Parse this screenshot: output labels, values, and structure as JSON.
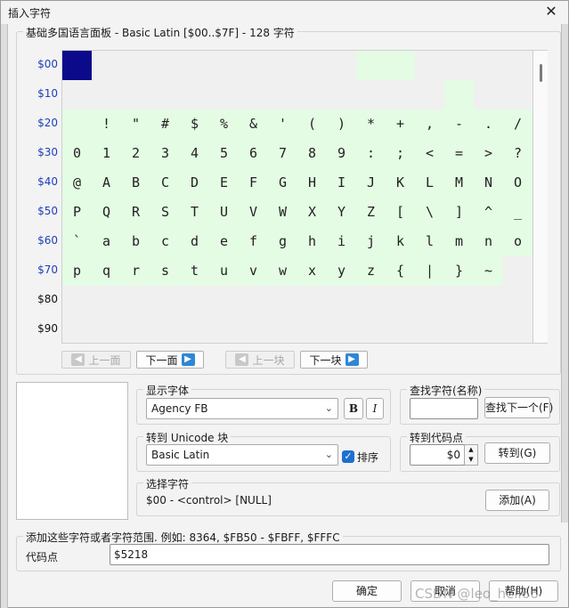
{
  "window": {
    "title": "插入字符",
    "close_label": "✕"
  },
  "panel": {
    "title": "基础多国语言面板 - Basic Latin [$00..$7F] - 128 字符"
  },
  "row_labels": [
    "$00",
    "$10",
    "$20",
    "$30",
    "$40",
    "$50",
    "$60",
    "$70",
    "$80",
    "$90"
  ],
  "rows": [
    [
      "",
      "",
      "",
      "",
      "",
      "",
      "",
      "",
      "",
      "",
      "",
      "",
      "",
      "",
      "",
      ""
    ],
    [
      "",
      "",
      "",
      "",
      "",
      "",
      "",
      "",
      "",
      "",
      "",
      "",
      "",
      "",
      "",
      ""
    ],
    [
      "",
      "!",
      "\"",
      "#",
      "$",
      "%",
      "&",
      "'",
      "(",
      ")",
      "*",
      "+",
      ",",
      "-",
      ".",
      "/"
    ],
    [
      "0",
      "1",
      "2",
      "3",
      "4",
      "5",
      "6",
      "7",
      "8",
      "9",
      ":",
      ";",
      "<",
      "=",
      ">",
      "?"
    ],
    [
      "@",
      "A",
      "B",
      "C",
      "D",
      "E",
      "F",
      "G",
      "H",
      "I",
      "J",
      "K",
      "L",
      "M",
      "N",
      "O"
    ],
    [
      "P",
      "Q",
      "R",
      "S",
      "T",
      "U",
      "V",
      "W",
      "X",
      "Y",
      "Z",
      "[",
      "\\",
      "]",
      "^",
      "_"
    ],
    [
      "`",
      "a",
      "b",
      "c",
      "d",
      "e",
      "f",
      "g",
      "h",
      "i",
      "j",
      "k",
      "l",
      "m",
      "n",
      "o"
    ],
    [
      "p",
      "q",
      "r",
      "s",
      "t",
      "u",
      "v",
      "w",
      "x",
      "y",
      "z",
      "{",
      "|",
      "}",
      "~",
      ""
    ],
    [
      "",
      "",
      "",
      "",
      "",
      "",
      "",
      "",
      "",
      "",
      "",
      "",
      "",
      "",
      "",
      ""
    ],
    [
      "",
      "",
      "",
      "",
      "",
      "",
      "",
      "",
      "",
      "",
      "",
      "",
      "",
      "",
      "",
      ""
    ]
  ],
  "nav": {
    "prev_page": "上一面",
    "next_page": "下一面",
    "prev_block": "上一块",
    "next_block": "下一块"
  },
  "font_group": {
    "label": "显示字体",
    "font_value": "Agency FB",
    "bold_label": "B",
    "italic_label": "I"
  },
  "find_group": {
    "label": "查找字符(名称)",
    "input_value": "",
    "find_next_button": "查找下一个(F)"
  },
  "unicode_group": {
    "label": "转到 Unicode 块",
    "block_value": "Basic Latin",
    "sort_label": "排序",
    "sort_checked": true
  },
  "codepoint_group": {
    "label": "转到代码点",
    "value": "$0",
    "goto_button": "转到(G)"
  },
  "select_group": {
    "label": "选择字符",
    "value": "$00 - <control> [NULL]",
    "add_button": "添加(A)"
  },
  "add_group": {
    "label": "添加这些字符或者字符范围. 例如: 8364, $FB50 - $FBFF, $FFFC",
    "field_label": "代码点",
    "field_value": "$5218"
  },
  "footer": {
    "ok": "确定",
    "cancel": "取消",
    "help": "帮助(H)"
  },
  "watermark": "CSDN @leo_hell66",
  "colors": {
    "selected_cell": "#0a0a8a",
    "active_cell": "#e4fbe4",
    "row_label_blue": "#1f3fb8",
    "arrow_blue": "#2f86d6",
    "checkbox_blue": "#1e6fd0"
  }
}
